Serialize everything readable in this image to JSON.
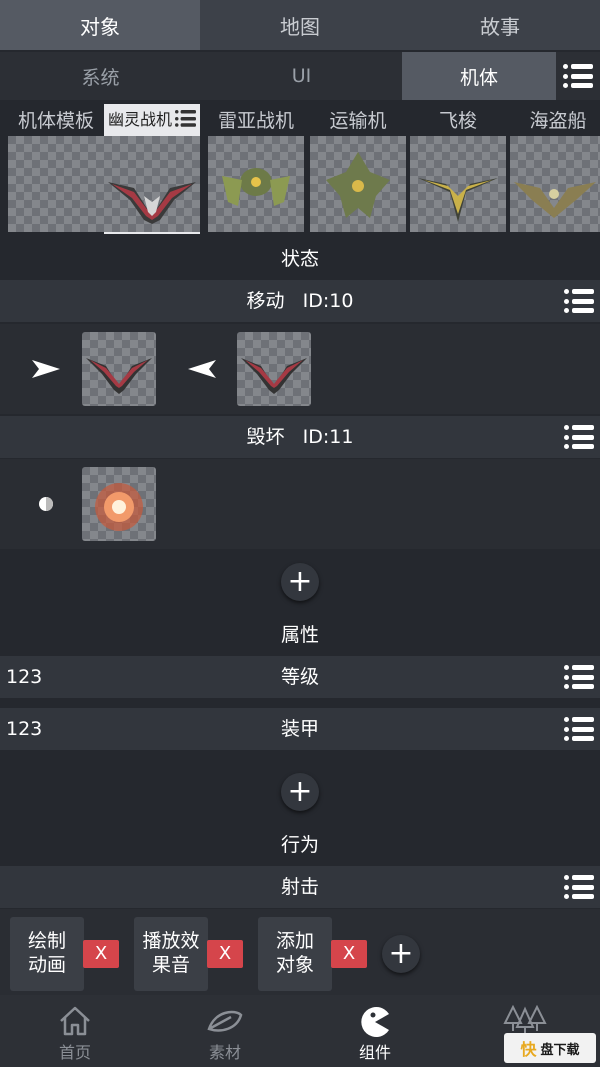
{
  "top_tabs": [
    "对象",
    "地图",
    "故事"
  ],
  "sub_tabs": [
    "系统",
    "UI",
    "机体"
  ],
  "ships": [
    {
      "name": "机体模板"
    },
    {
      "name": "幽灵战机"
    },
    {
      "name": "雷亚战机"
    },
    {
      "name": "运输机"
    },
    {
      "name": "飞梭"
    },
    {
      "name": "海盗船"
    }
  ],
  "state": {
    "title": "状态",
    "move": {
      "label": "移动",
      "id": "ID:10"
    },
    "destroy": {
      "label": "毁坏",
      "id": "ID:11"
    }
  },
  "attributes": {
    "title": "属性",
    "items": [
      {
        "value": "123",
        "label": "等级"
      },
      {
        "value": "123",
        "label": "装甲"
      }
    ]
  },
  "behavior": {
    "title": "行为",
    "event": "射击",
    "actions": [
      {
        "line1": "绘制",
        "line2": "动画"
      },
      {
        "line1": "播放效",
        "line2": "果音"
      },
      {
        "line1": "添加",
        "line2": "对象"
      }
    ],
    "remove_label": "X"
  },
  "bottom_nav": [
    "首页",
    "素材",
    "组件",
    ""
  ],
  "watermark": {
    "brand": "快",
    "text": "盘下载"
  },
  "colors": {
    "accent_red": "#d5454b",
    "active_tab": "#555a63",
    "background": "#25282e"
  }
}
